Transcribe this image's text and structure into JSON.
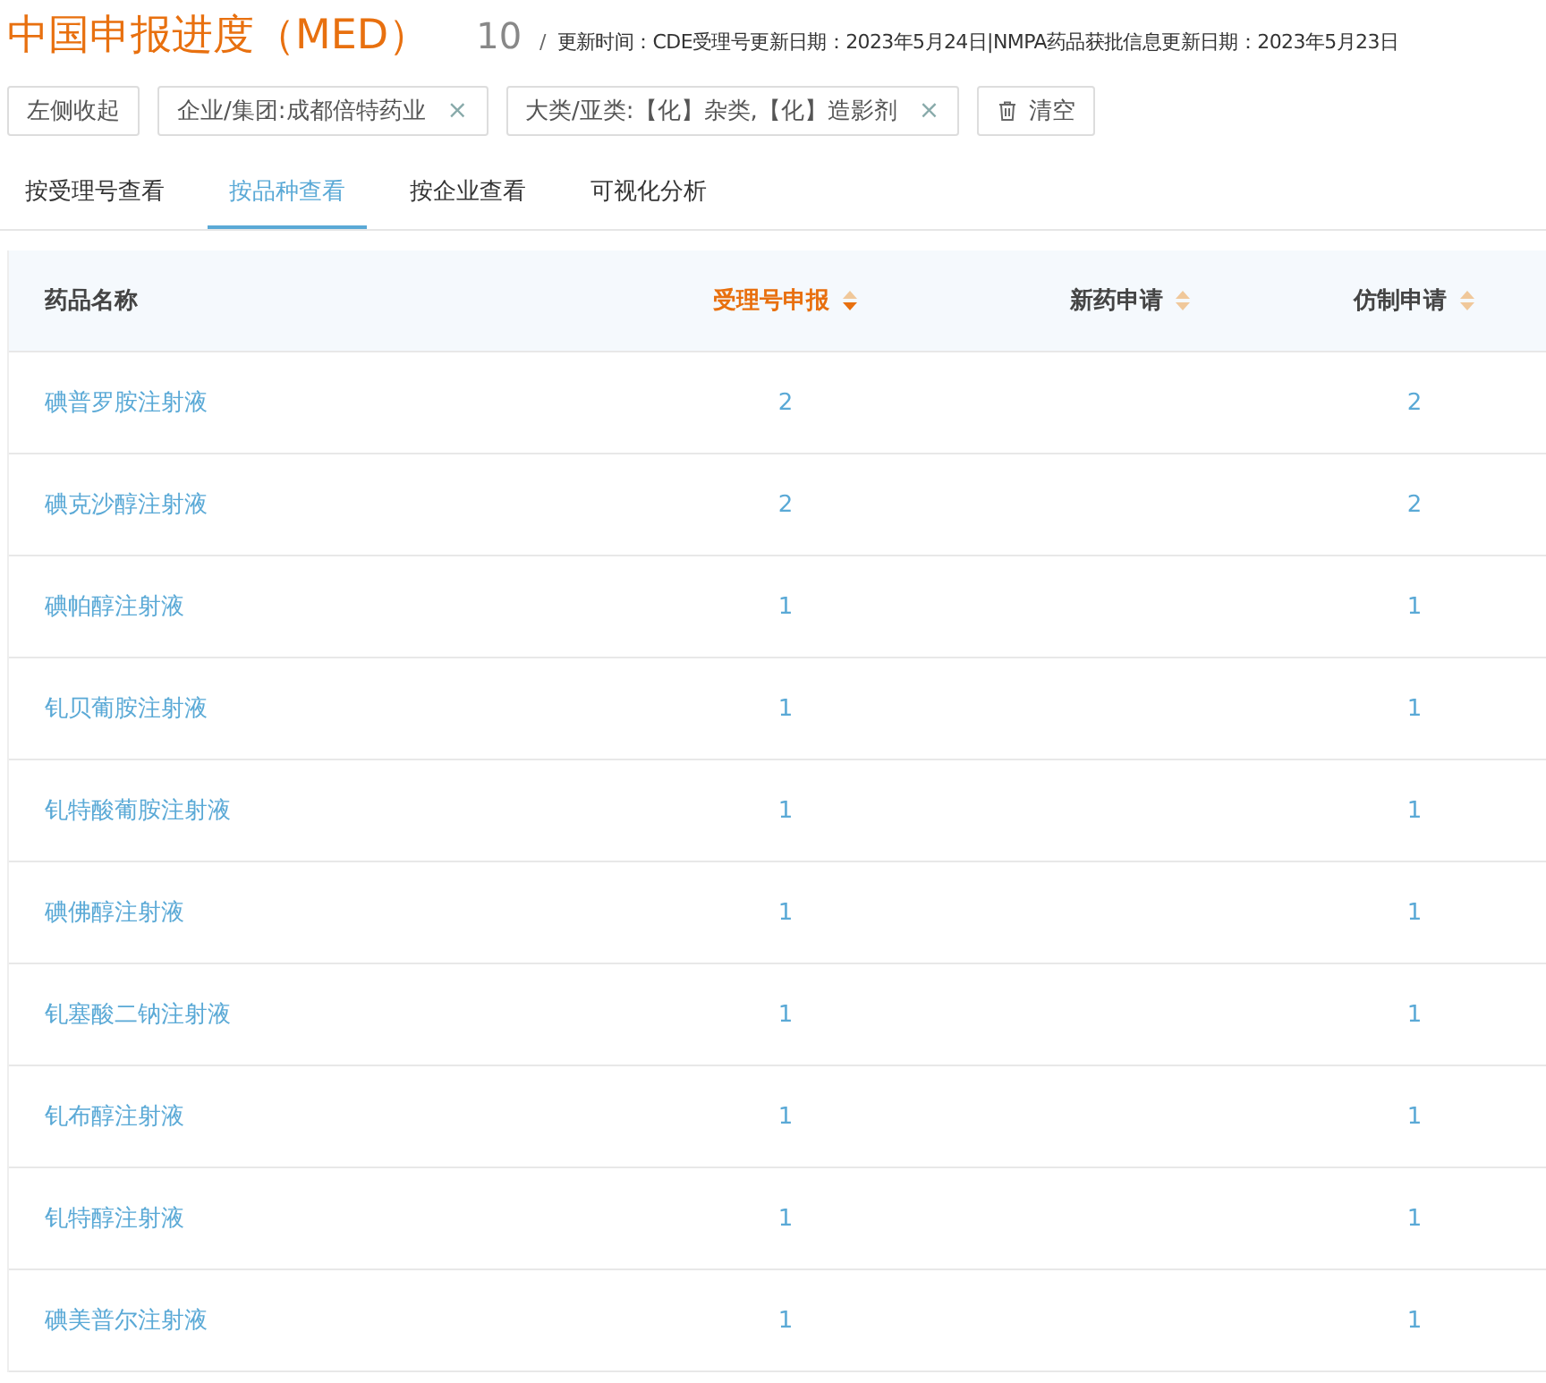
{
  "header": {
    "title": "中国申报进度（MED）",
    "count": "10",
    "separator": "/",
    "update_info": "更新时间：CDE受理号更新日期：2023年5月24日|NMPA药品获批信息更新日期：2023年5月23日"
  },
  "filters": [
    {
      "kind": "button",
      "label": "左侧收起"
    },
    {
      "kind": "tag",
      "label": "企业/集团:成都倍特药业",
      "close": "×"
    },
    {
      "kind": "tag",
      "label": "大类/亚类:【化】杂类,【化】造影剂",
      "close": "×"
    },
    {
      "kind": "clear",
      "label": "清空"
    }
  ],
  "tabs": [
    {
      "label": "按受理号查看",
      "selected": false
    },
    {
      "label": "按品种查看",
      "selected": true
    },
    {
      "label": "按企业查看",
      "selected": false
    },
    {
      "label": "可视化分析",
      "selected": false
    }
  ],
  "table": {
    "columns": [
      {
        "label": "药品名称",
        "kind": "plain"
      },
      {
        "label": "受理号申报",
        "kind": "sortable",
        "sorted": true
      },
      {
        "label": "新药申请",
        "kind": "sortable",
        "sorted": false
      },
      {
        "label": "仿制申请",
        "kind": "sortable",
        "sorted": false
      }
    ],
    "rows": [
      {
        "name": "碘普罗胺注射液",
        "accepted": "2",
        "generic": "2"
      },
      {
        "name": "碘克沙醇注射液",
        "accepted": "2",
        "generic": "2"
      },
      {
        "name": "碘帕醇注射液",
        "accepted": "1",
        "generic": "1"
      },
      {
        "name": "钆贝葡胺注射液",
        "accepted": "1",
        "generic": "1"
      },
      {
        "name": "钆特酸葡胺注射液",
        "accepted": "1",
        "generic": "1"
      },
      {
        "name": "碘佛醇注射液",
        "accepted": "1",
        "generic": "1"
      },
      {
        "name": "钆塞酸二钠注射液",
        "accepted": "1",
        "generic": "1"
      },
      {
        "name": "钆布醇注射液",
        "accepted": "1",
        "generic": "1"
      },
      {
        "name": "钆特醇注射液",
        "accepted": "1",
        "generic": "1"
      },
      {
        "name": "碘美普尔注射液",
        "accepted": "1",
        "generic": "1"
      }
    ]
  }
}
